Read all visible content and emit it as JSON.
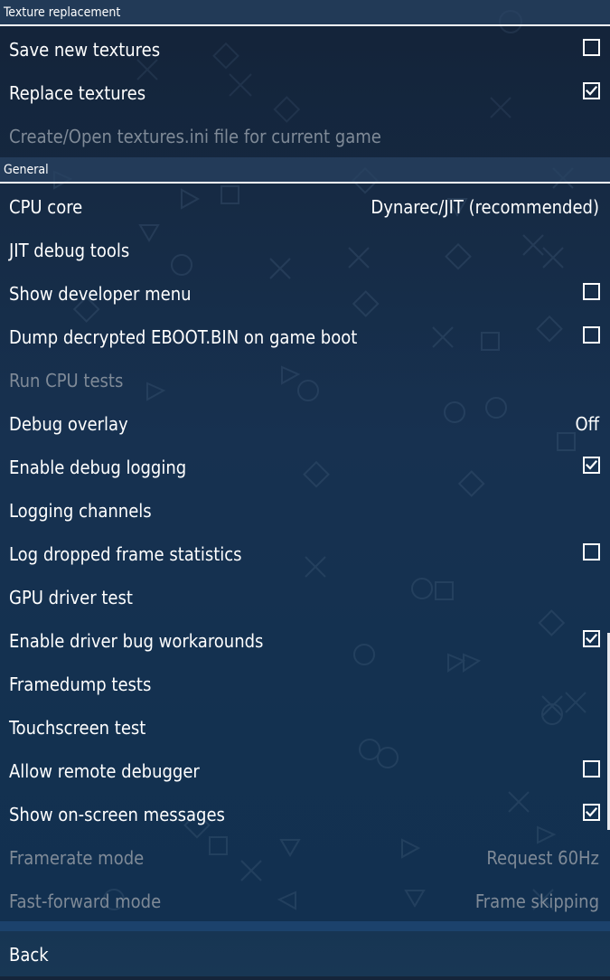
{
  "sections": {
    "texture_replacement": {
      "title": "Texture replacement",
      "items": [
        {
          "label": "Save new textures",
          "checked": false
        },
        {
          "label": "Replace textures",
          "checked": true
        },
        {
          "label": "Create/Open textures.ini file for current game",
          "disabled": true
        }
      ]
    },
    "general": {
      "title": "General",
      "items": [
        {
          "label": "CPU core",
          "value": "Dynarec/JIT (recommended)"
        },
        {
          "label": "JIT debug tools"
        },
        {
          "label": "Show developer menu",
          "checked": false
        },
        {
          "label": "Dump decrypted EBOOT.BIN on game boot",
          "checked": false
        },
        {
          "label": "Run CPU tests",
          "disabled": true
        },
        {
          "label": "Debug overlay",
          "value": "Off"
        },
        {
          "label": "Enable debug logging",
          "checked": true
        },
        {
          "label": "Logging channels"
        },
        {
          "label": "Log dropped frame statistics",
          "checked": false
        },
        {
          "label": "GPU driver test"
        },
        {
          "label": "Enable driver bug workarounds",
          "checked": true
        },
        {
          "label": "Framedump tests"
        },
        {
          "label": "Touchscreen test"
        },
        {
          "label": "Allow remote debugger",
          "checked": false
        },
        {
          "label": "Show on-screen messages",
          "checked": true
        },
        {
          "label": "Framerate mode",
          "value": "Request 60Hz",
          "disabled": true
        },
        {
          "label": "Fast-forward mode",
          "value": "Frame skipping",
          "disabled": true
        }
      ]
    }
  },
  "footer": {
    "back_label": "Back"
  },
  "icons": {
    "checkbox_empty": "checkbox-unchecked-icon",
    "checkbox_checked": "checkbox-checked-icon"
  },
  "colors": {
    "disabled_text": "#7f8a97",
    "header_bg": "#284263",
    "background": "#15253a"
  }
}
